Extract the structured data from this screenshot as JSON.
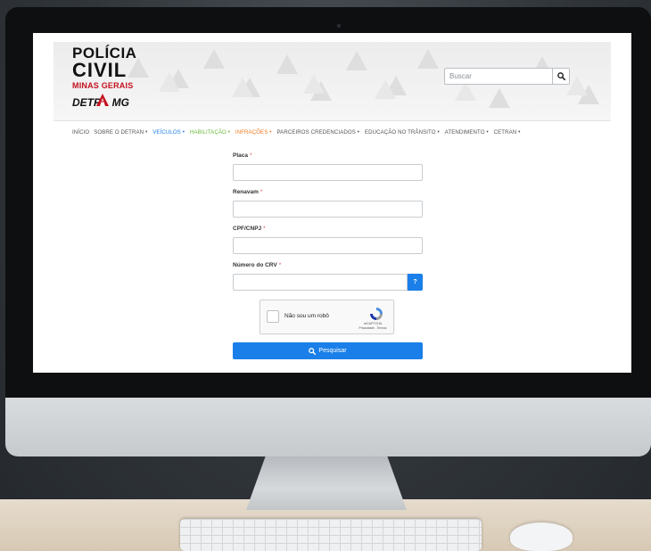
{
  "header": {
    "logo": {
      "line1": "POLÍCIA",
      "line2": "CIVIL",
      "line3": "MINAS GERAIS",
      "line4_prefix": "DETR",
      "line4_suffix": "MG"
    },
    "search": {
      "placeholder": "Buscar",
      "icon": "search-icon"
    }
  },
  "nav": {
    "items": [
      {
        "label": "INÍCIO",
        "color": "#555555",
        "dropdown": false
      },
      {
        "label": "SOBRE O DETRAN",
        "color": "#555555",
        "dropdown": true
      },
      {
        "label": "VEÍCULOS",
        "color": "#1a7fe8",
        "dropdown": true
      },
      {
        "label": "HABILITAÇÃO",
        "color": "#6bb83a",
        "dropdown": true
      },
      {
        "label": "INFRAÇÕES",
        "color": "#f07a20",
        "dropdown": true
      },
      {
        "label": "PARCEIROS CREDENCIADOS",
        "color": "#555555",
        "dropdown": true
      },
      {
        "label": "EDUCAÇÃO NO TRÂNSITO",
        "color": "#555555",
        "dropdown": true
      },
      {
        "label": "ATENDIMENTO",
        "color": "#555555",
        "dropdown": true
      },
      {
        "label": "CETRAN",
        "color": "#555555",
        "dropdown": true
      }
    ]
  },
  "form": {
    "fields": [
      {
        "label": "Placa",
        "required_mark": "*",
        "value": ""
      },
      {
        "label": "Renavam",
        "required_mark": "*",
        "value": ""
      },
      {
        "label": "CPF/CNPJ",
        "required_mark": "*",
        "value": ""
      },
      {
        "label": "Número do CRV",
        "required_mark": "*",
        "value": "",
        "help_label": "?"
      }
    ],
    "captcha": {
      "label": "Não sou um robô",
      "brand": "reCAPTCHA",
      "terms": "Privacidade - Termos",
      "checked": false
    },
    "submit_label": "Pesquisar",
    "submit_icon": "search-icon"
  },
  "colors": {
    "primary": "#1a7fe8",
    "required": "#d9534f",
    "logo_red": "#c3121f"
  }
}
